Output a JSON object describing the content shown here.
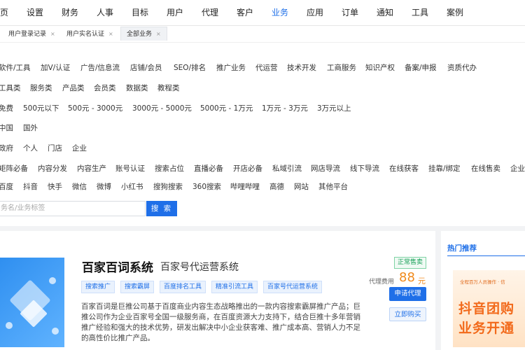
{
  "topnav": [
    "页",
    "设置",
    "财务",
    "人事",
    "目标",
    "用户",
    "代理",
    "客户",
    "业务",
    "应用",
    "订单",
    "通知",
    "工具",
    "案例"
  ],
  "topnav_active": "业务",
  "tabs": [
    {
      "label": "用户登录记录",
      "close": "×"
    },
    {
      "label": "用户实名认证",
      "close": "×"
    },
    {
      "label": "全部业务",
      "close": "×"
    }
  ],
  "filters": [
    [
      "软件/工具",
      "加V/认证",
      "广告/信息流",
      "店铺/会员",
      "SEO/排名",
      "推广业务",
      "代运营",
      "技术开发",
      "工商服务",
      "知识产权",
      "备案/申报",
      "资质代办"
    ],
    [
      "工具类",
      "服务类",
      "产品类",
      "会员类",
      "数据类",
      "教程类"
    ],
    [
      "免费",
      "500元以下",
      "500元 - 3000元",
      "3000元 - 5000元",
      "5000元 - 1万元",
      "1万元 - 3万元",
      "3万元以上"
    ],
    [
      "中国",
      "国外"
    ],
    [
      "政府",
      "个人",
      "门店",
      "企业"
    ],
    [
      "矩阵必备",
      "内容分发",
      "内容生产",
      "账号认证",
      "搜索占位",
      "直播必备",
      "开店必备",
      "私域引流",
      "网店导流",
      "线下导流",
      "在线获客",
      "挂靠/绑定",
      "在线售卖",
      "企业"
    ],
    [
      "百度",
      "抖音",
      "快手",
      "微信",
      "微博",
      "小红书",
      "搜狗搜索",
      "360搜索",
      "哔哩哔哩",
      "高德",
      "网站",
      "其他平台"
    ]
  ],
  "search": {
    "placeholder": "务名/业务标签",
    "button": "搜 索"
  },
  "product": {
    "title": "百家百词系统",
    "subtitle": "百家号代运营系统",
    "tags": [
      "搜索推广",
      "搜索霸屏",
      "百度排名工具",
      "精准引流工具",
      "百家号代运营系统"
    ],
    "desc": [
      "百家百词是巨推公司基于百度商业内容生态战略推出的一款内容搜索霸屏推广产品；巨",
      "推公司作为企业百家号全国一级服务商，在百度资源大力支持下，结合巨推十多年营销",
      "推广经验和强大的技术优势，研发出解决中小企业获客难、推广成本高、营销人力不足",
      "的高性价比推广产品。"
    ],
    "status": "正常售卖",
    "fee_label": "代理费用",
    "fee": "88",
    "fee_unit": "元",
    "apply_button": "申请代理",
    "buy_button": "立即购买"
  },
  "side": {
    "title": "热门推荐",
    "ad_strip": "全程百万人员操作 · 信",
    "ad_line1": "抖音团购",
    "ad_line2": "业务开通"
  },
  "colors": {
    "accent": "#1f6fe8",
    "price": "#f08a1c",
    "status": "#18a058"
  }
}
